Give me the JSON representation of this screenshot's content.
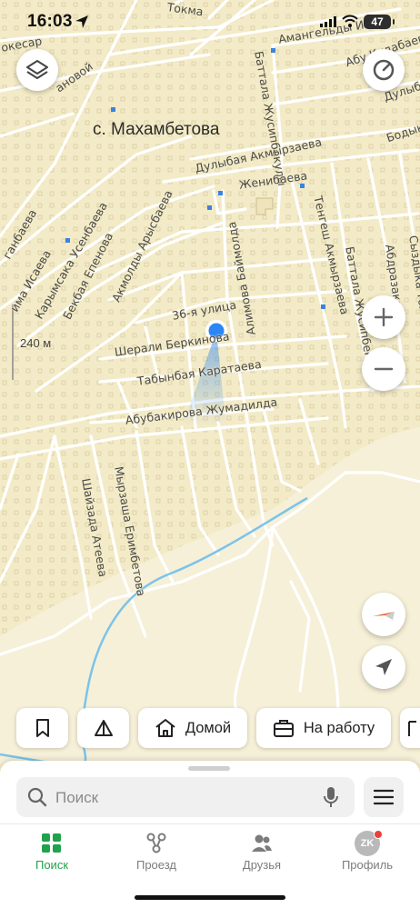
{
  "status_bar": {
    "time": "16:03",
    "battery": "47"
  },
  "map": {
    "village": "с. Махамбетова",
    "scale": "240 м",
    "streets": {
      "tokma": "Токма",
      "amangeldy": "Амангельды Има",
      "abu": "Абу Кудабаева",
      "dulybaya_top": "Дулыбая",
      "kesar": "окесар",
      "anovoi": "ановой",
      "battala1": "Баттала Жусипбекулы",
      "bodyka": "Бодыка",
      "dulybai": "Дулыбая Акмырзаева",
      "zhenibaeva": "Женибаева",
      "tengesh": "Тенгеш Акмырзаева",
      "battala2": "Баттала Жусипбекулы",
      "abdrazak": "Абдразака",
      "syzdyk": "Сыздыка Толекова",
      "gan": "ганбаева",
      "ima": "има Исаева",
      "karym": "Карымсака Усенбаева",
      "bekbaya": "Бекбая Епенова",
      "akmoldy": "Акмолды Арысбаева",
      "alimova": "Алимова Баймолда",
      "ulitsa36": "36-я улица",
      "sherali": "Шерали Беркинова",
      "tabynbaya": "Табынбая Каратаева",
      "abubakirova": "Абубакирова Жумадилда",
      "shaizada": "Шайзада Атеева",
      "myrzasha": "Мырзаша Еримбетова"
    }
  },
  "chips": {
    "home": "Домой",
    "work": "На работу"
  },
  "search": {
    "placeholder": "Поиск"
  },
  "tabs": {
    "search": "Поиск",
    "transit": "Проезд",
    "friends": "Друзья",
    "profile": "Профиль",
    "avatar_initials": "ZK"
  },
  "colors": {
    "accent": "#1fa24a",
    "map_bg": "#f3ebc7",
    "user_dot": "#2b86f4",
    "river": "#7bc3ea"
  }
}
